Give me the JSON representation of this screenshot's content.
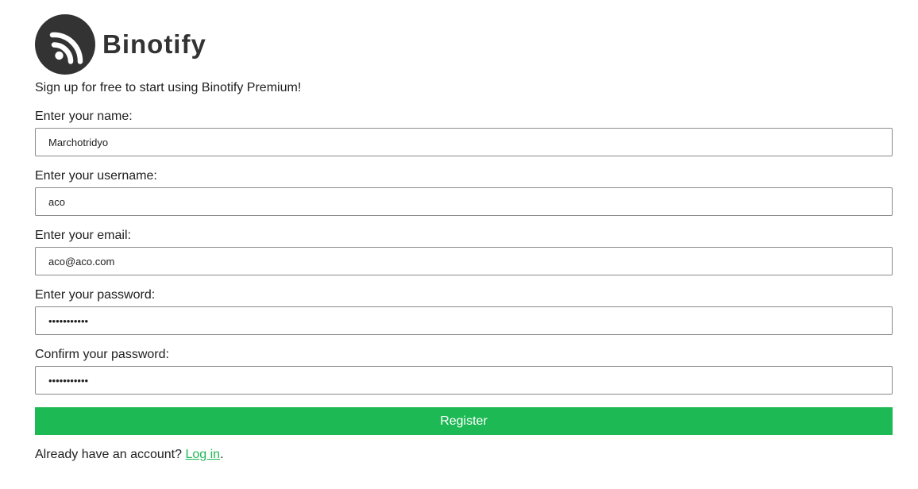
{
  "brand": {
    "name": "Binotify",
    "icon": "rss-feed-icon"
  },
  "tagline": "Sign up for free to start using Binotify Premium!",
  "form": {
    "fields": [
      {
        "label": "Enter your name:",
        "value": "Marchotridyo",
        "type": "text"
      },
      {
        "label": "Enter your username:",
        "value": "aco",
        "type": "text"
      },
      {
        "label": "Enter your email:",
        "value": "aco@aco.com",
        "type": "email"
      },
      {
        "label": "Enter your password:",
        "value": "•••••••••••",
        "type": "password"
      },
      {
        "label": "Confirm your password:",
        "value": "•••••••••••",
        "type": "password"
      }
    ],
    "submit_label": "Register"
  },
  "footer": {
    "prompt": "Already have an account? ",
    "link_label": "Log in",
    "suffix": "."
  },
  "colors": {
    "accent": "#1db954",
    "logo_bg": "#333333"
  }
}
